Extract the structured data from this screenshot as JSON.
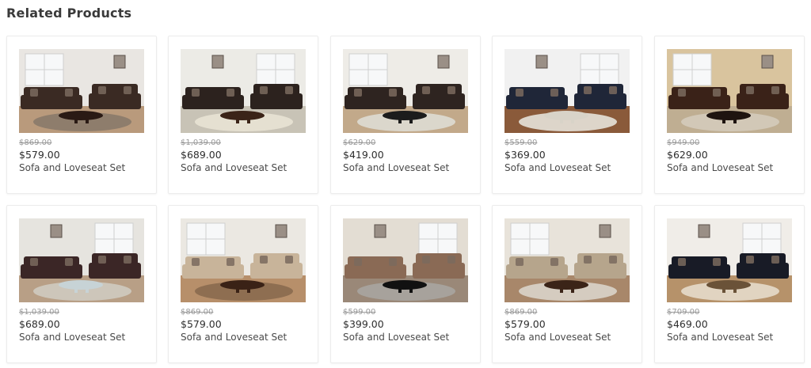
{
  "section": {
    "title": "Related Products"
  },
  "products": [
    {
      "old_price": "$869.00",
      "price": "$579.00",
      "name": "Sofa and Loveseat Set",
      "wall": "#e9e6e2",
      "floor": "#b99a7c",
      "sofa": "#3a2a23",
      "rug": "#8a7a6a",
      "table": "#2a1a14"
    },
    {
      "old_price": "$1,039.00",
      "price": "$689.00",
      "name": "Sofa and Loveseat Set",
      "wall": "#ecebe6",
      "floor": "#c8c3b6",
      "sofa": "#2c221e",
      "rug": "#e8e3d4",
      "table": "#3b2418"
    },
    {
      "old_price": "$629.00",
      "price": "$419.00",
      "name": "Sofa and Loveseat Set",
      "wall": "#eeece7",
      "floor": "#c2a98a",
      "sofa": "#2e2420",
      "rug": "#dedbd3",
      "table": "#1c1c1c"
    },
    {
      "old_price": "$559.00",
      "price": "$369.00",
      "name": "Sofa and Loveseat Set",
      "wall": "#f1f1f1",
      "floor": "#8a5a3a",
      "sofa": "#1f2638",
      "rug": "#e6e2da",
      "table": "#d8d3c8"
    },
    {
      "old_price": "$949.00",
      "price": "$629.00",
      "name": "Sofa and Loveseat Set",
      "wall": "#d9c49e",
      "floor": "#bfae92",
      "sofa": "#3a2218",
      "rug": "#d4cbbb",
      "table": "#1e1410"
    },
    {
      "old_price": "$1,039.00",
      "price": "$689.00",
      "name": "Sofa and Loveseat Set",
      "wall": "#e6e4df",
      "floor": "#b89f86",
      "sofa": "#3b2626",
      "rug": "#cfcac0",
      "table": "#c7d3d6"
    },
    {
      "old_price": "$869.00",
      "price": "$579.00",
      "name": "Sofa and Loveseat Set",
      "wall": "#ebe8e2",
      "floor": "#b78f6a",
      "sofa": "#c8b49a",
      "rug": "#8a6a4f",
      "table": "#3a2216"
    },
    {
      "old_price": "$599.00",
      "price": "$399.00",
      "name": "Sofa and Loveseat Set",
      "wall": "#e3ddd3",
      "floor": "#9a8878",
      "sofa": "#8a6a55",
      "rug": "#a9a5a0",
      "table": "#111111"
    },
    {
      "old_price": "$869.00",
      "price": "$579.00",
      "name": "Sofa and Loveseat Set",
      "wall": "#e8e3da",
      "floor": "#a8876a",
      "sofa": "#b6a58c",
      "rug": "#d9d4ca",
      "table": "#3b2418"
    },
    {
      "old_price": "$709.00",
      "price": "$469.00",
      "name": "Sofa and Loveseat Set",
      "wall": "#f0ede8",
      "floor": "#b6926a",
      "sofa": "#181b26",
      "rug": "#e6dccb",
      "table": "#6a5238"
    }
  ]
}
